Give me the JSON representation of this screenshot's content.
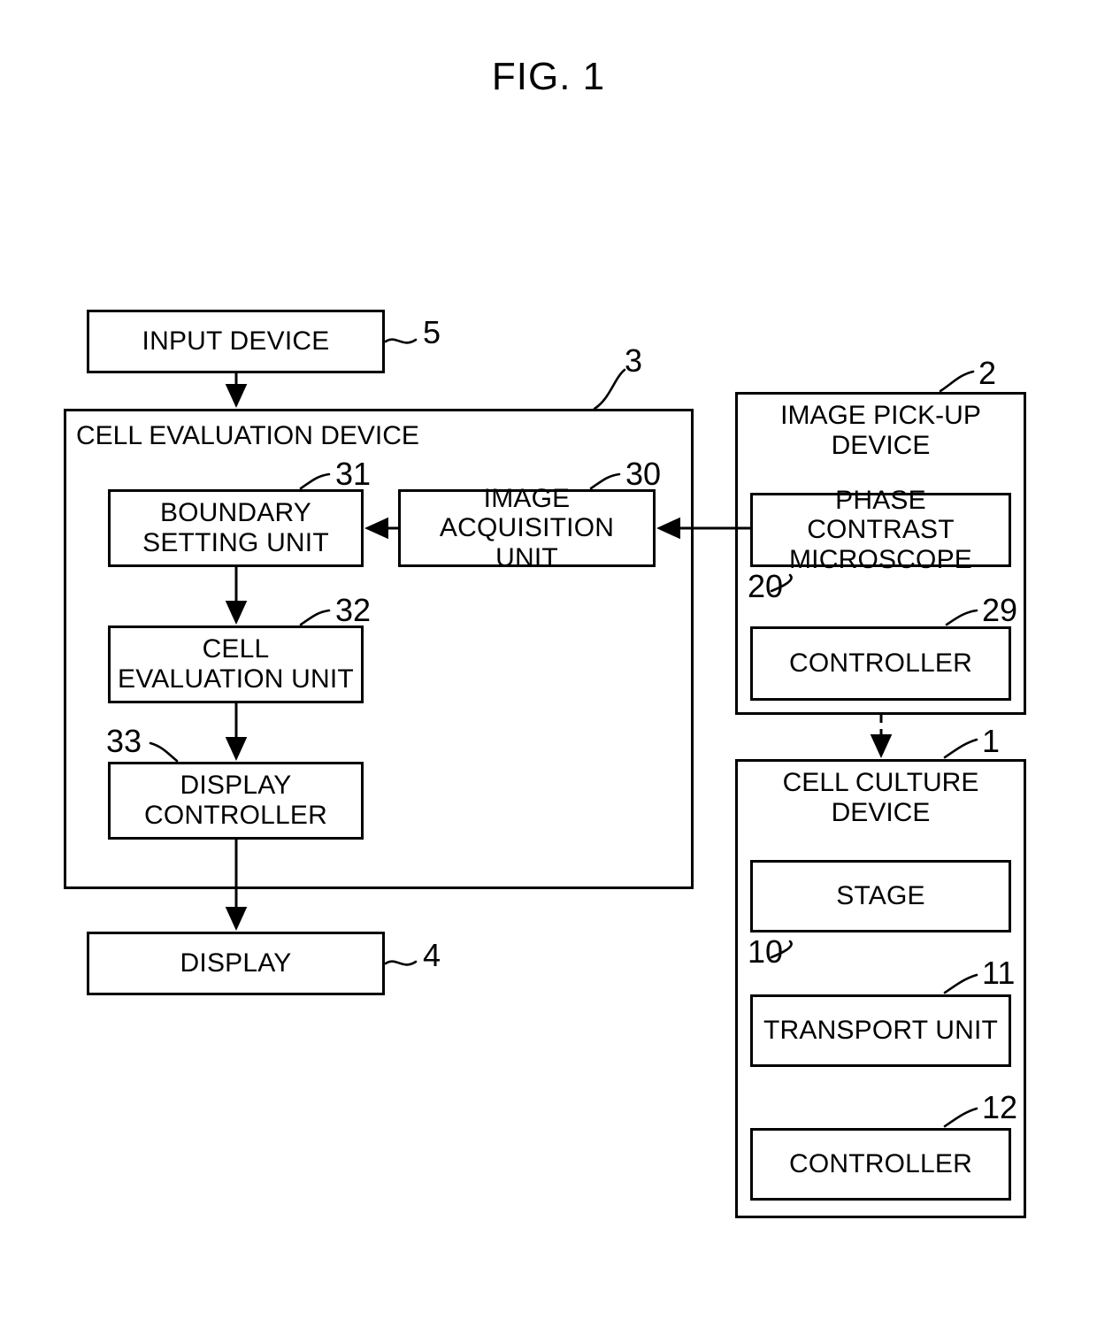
{
  "figure": {
    "title": "FIG. 1",
    "type": "patent-block-diagram"
  },
  "blocks": {
    "input_device": {
      "label": "INPUT DEVICE",
      "ref": "5"
    },
    "cell_evaluation_device": {
      "label": "CELL EVALUATION DEVICE",
      "ref": "3"
    },
    "boundary_setting_unit": {
      "label": "BOUNDARY\nSETTING UNIT",
      "ref": "31"
    },
    "image_acquisition_unit": {
      "label": "IMAGE\nACQUISITION UNIT",
      "ref": "30"
    },
    "cell_evaluation_unit": {
      "label": "CELL\nEVALUATION UNIT",
      "ref": "32"
    },
    "display_controller": {
      "label": "DISPLAY\nCONTROLLER",
      "ref": "33"
    },
    "display": {
      "label": "DISPLAY",
      "ref": "4"
    },
    "image_pickup_device": {
      "label": "IMAGE PICK-UP\nDEVICE",
      "ref": "2"
    },
    "phase_contrast_microscope": {
      "label": "PHASE CONTRAST\nMICROSCOPE",
      "ref": "20"
    },
    "pickup_controller": {
      "label": "CONTROLLER",
      "ref": "29"
    },
    "cell_culture_device": {
      "label": "CELL CULTURE\nDEVICE",
      "ref": "1"
    },
    "stage": {
      "label": "STAGE",
      "ref": "10"
    },
    "transport_unit": {
      "label": "TRANSPORT UNIT",
      "ref": "11"
    },
    "culture_controller": {
      "label": "CONTROLLER",
      "ref": "12"
    }
  },
  "colors": {
    "ink": "#000000",
    "paper": "#ffffff"
  }
}
